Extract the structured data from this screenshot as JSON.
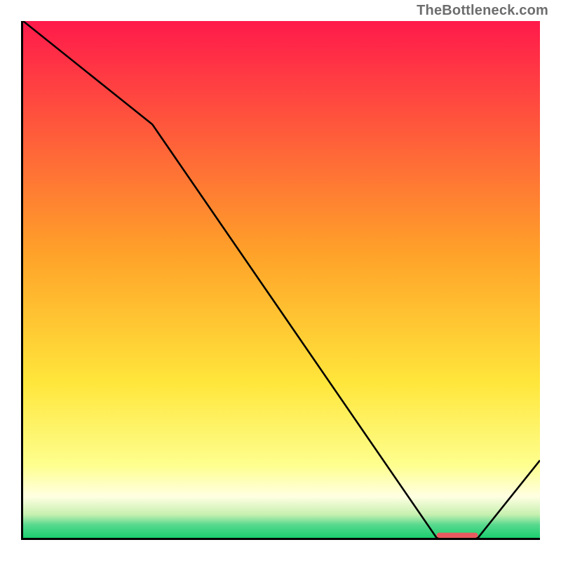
{
  "watermark": "TheBottleneck.com",
  "chart_data": {
    "type": "line",
    "title": "",
    "xlabel": "",
    "ylabel": "",
    "xlim": [
      0,
      100
    ],
    "ylim": [
      0,
      100
    ],
    "x": [
      0,
      25,
      80,
      88,
      100
    ],
    "values": [
      100,
      80,
      0,
      0,
      15
    ],
    "optimal_marker": {
      "x_start": 80,
      "x_end": 88,
      "y": 0
    },
    "background_gradient_stops": [
      {
        "pos": 0.0,
        "color": "#ff1a4b"
      },
      {
        "pos": 0.45,
        "color": "#ffa229"
      },
      {
        "pos": 0.7,
        "color": "#ffe63b"
      },
      {
        "pos": 0.86,
        "color": "#feff8f"
      },
      {
        "pos": 0.92,
        "color": "#ffffe2"
      },
      {
        "pos": 0.955,
        "color": "#c7f0b0"
      },
      {
        "pos": 0.975,
        "color": "#56d98e"
      },
      {
        "pos": 1.0,
        "color": "#1bce6f"
      }
    ]
  }
}
